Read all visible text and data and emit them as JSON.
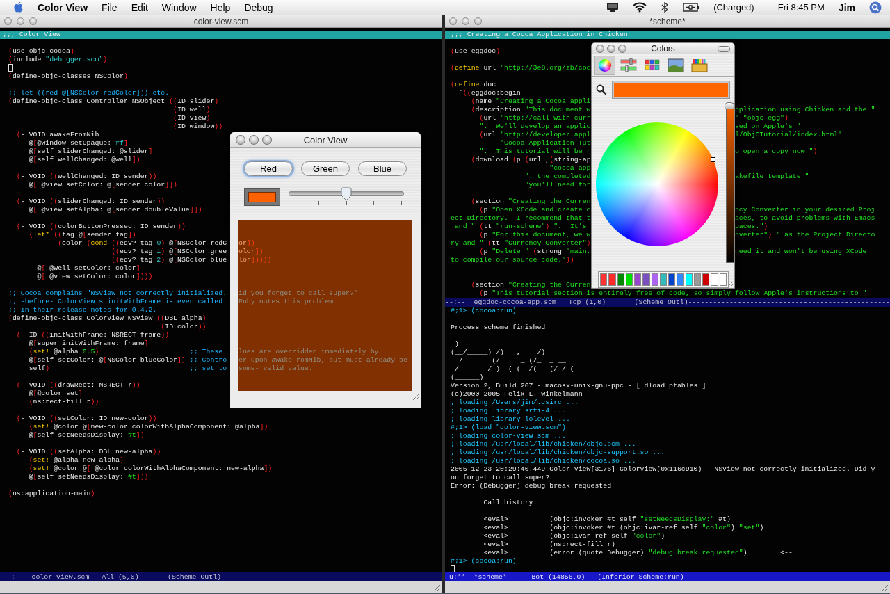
{
  "menubar": {
    "app": "Color View",
    "items": [
      "File",
      "Edit",
      "Window",
      "Help",
      "Debug"
    ],
    "battery": "(Charged)",
    "clock": "Fri 8:45 PM",
    "user": "Jim"
  },
  "editor_left": {
    "title": "color-view.scm",
    "header": ";;; Color View",
    "lines": [
      {
        "kind": "blank"
      },
      {
        "kind": "code",
        "segs": [
          {
            "kind": "code",
            "text": "(use objc cocoa)"
          }
        ]
      },
      {
        "kind": "code",
        "segs": [
          {
            "kind": "code",
            "text": "(include "
          },
          {
            "kind": "string",
            "text": "\"debugger.scm\""
          },
          {
            "kind": "code",
            "text": ")"
          }
        ]
      },
      {
        "kind": "cursor"
      },
      {
        "kind": "code",
        "segs": [
          {
            "kind": "code",
            "text": "(define-objc-classes NSColor)"
          }
        ]
      },
      {
        "kind": "blank"
      },
      {
        "kind": "code",
        "segs": [
          {
            "kind": "comment",
            "text": ";; let ((red @[NSColor redColor])) etc."
          }
        ]
      },
      {
        "kind": "code",
        "segs": [
          {
            "kind": "code",
            "text": "(define-objc-class Controller NSObject ((ID slider)"
          }
        ]
      },
      {
        "kind": "code",
        "segs": [
          {
            "kind": "code",
            "text": "                                        (ID well)"
          }
        ]
      },
      {
        "kind": "code",
        "segs": [
          {
            "kind": "code",
            "text": "                                        (ID view)"
          }
        ]
      },
      {
        "kind": "code",
        "segs": [
          {
            "kind": "code",
            "text": "                                        (ID window))"
          }
        ]
      },
      {
        "kind": "code",
        "segs": [
          {
            "kind": "code",
            "text": "  (- VOID awakeFromNib"
          }
        ]
      },
      {
        "kind": "code",
        "segs": [
          {
            "kind": "code",
            "text": "     @[@window setOpaque: "
          },
          {
            "kind": "constant",
            "text": "#f"
          },
          {
            "kind": "code",
            "text": "]"
          }
        ]
      },
      {
        "kind": "code",
        "segs": [
          {
            "kind": "code",
            "text": "     @[self sliderChanged: @slider]"
          }
        ]
      },
      {
        "kind": "code",
        "segs": [
          {
            "kind": "code",
            "text": "     @[self wellChanged: @well])"
          }
        ]
      },
      {
        "kind": "blank"
      },
      {
        "kind": "code",
        "segs": [
          {
            "kind": "code",
            "text": "  (- VOID ((wellChanged: ID sender))"
          }
        ]
      },
      {
        "kind": "code",
        "segs": [
          {
            "kind": "code",
            "text": "     @[ @view setColor: @[sender color]])"
          }
        ]
      },
      {
        "kind": "blank"
      },
      {
        "kind": "code",
        "segs": [
          {
            "kind": "code",
            "text": "  (- VOID ((sliderChanged: ID sender))"
          }
        ]
      },
      {
        "kind": "code",
        "segs": [
          {
            "kind": "code",
            "text": "     @[ @view setAlpha: @[sender doubleValue]])"
          }
        ]
      },
      {
        "kind": "blank"
      },
      {
        "kind": "code",
        "segs": [
          {
            "kind": "code",
            "text": "  (- VOID ((colorButtonPressed: ID sender))"
          }
        ]
      },
      {
        "kind": "code",
        "segs": [
          {
            "kind": "code",
            "text": "     ("
          },
          {
            "kind": "keyword",
            "text": "let*"
          },
          {
            "kind": "code",
            "text": " ((tag @[sender tag])"
          }
        ]
      },
      {
        "kind": "code",
        "segs": [
          {
            "kind": "code",
            "text": "            (color ("
          },
          {
            "kind": "keyword",
            "text": "cond"
          },
          {
            "kind": "code",
            "text": " ((eqv? tag "
          },
          {
            "kind": "constant",
            "text": "0"
          },
          {
            "kind": "code",
            "text": ") @[NSColor redC"
          }
        ],
        "after": [
          {
            "kind": "code",
            "text": "or])"
          }
        ]
      },
      {
        "kind": "code",
        "segs": [
          {
            "kind": "code",
            "text": "                         ((eqv? tag "
          },
          {
            "kind": "constant",
            "text": "1"
          },
          {
            "kind": "code",
            "text": ") @[NSColor gree"
          }
        ],
        "after": [
          {
            "kind": "code",
            "text": "olor])"
          }
        ]
      },
      {
        "kind": "code",
        "segs": [
          {
            "kind": "code",
            "text": "                         ((eqv? tag "
          },
          {
            "kind": "constant",
            "text": "2"
          },
          {
            "kind": "code",
            "text": ") @[NSColor blue"
          }
        ],
        "after": [
          {
            "kind": "code",
            "text": "lor]))))"
          }
        ]
      },
      {
        "kind": "code",
        "segs": [
          {
            "kind": "code",
            "text": "       @[ @well setColor: color]"
          }
        ]
      },
      {
        "kind": "code",
        "segs": [
          {
            "kind": "code",
            "text": "       @[ @view setColor: color])))"
          }
        ]
      },
      {
        "kind": "blank"
      },
      {
        "kind": "code",
        "segs": [
          {
            "kind": "comment",
            "text": ";; Cocoa complains \"NSView not correctly initialized."
          }
        ],
        "after": [
          {
            "kind": "comment",
            "text": "id you forget to call super?\""
          }
        ]
      },
      {
        "kind": "code",
        "segs": [
          {
            "kind": "comment",
            "text": ";; -before- ColorView's initWithFrame is even called."
          }
        ],
        "after": [
          {
            "kind": "comment",
            "text": "Ruby notes this problem"
          }
        ]
      },
      {
        "kind": "code",
        "segs": [
          {
            "kind": "comment",
            "text": ";; in their release notes for 0.4.2."
          }
        ]
      },
      {
        "kind": "code",
        "segs": [
          {
            "kind": "code",
            "text": "(define-objc-class ColorView NSView ((DBL alpha)"
          }
        ]
      },
      {
        "kind": "code",
        "segs": [
          {
            "kind": "code",
            "text": "                                     (ID color))"
          }
        ]
      },
      {
        "kind": "code",
        "segs": [
          {
            "kind": "code",
            "text": "  (- ID ((initWithFrame: NSRECT frame))"
          }
        ]
      },
      {
        "kind": "code",
        "segs": [
          {
            "kind": "code",
            "text": "     @[super initWithFrame: frame]"
          }
        ]
      },
      {
        "kind": "code",
        "segs": [
          {
            "kind": "code",
            "text": "     ("
          },
          {
            "kind": "keyword",
            "text": "set!"
          },
          {
            "kind": "code",
            "text": " @alpha "
          },
          {
            "kind": "number",
            "text": "0.5"
          },
          {
            "kind": "code",
            "text": ")                      "
          },
          {
            "kind": "comment",
            "text": ";; These"
          }
        ],
        "after": [
          {
            "kind": "comment",
            "text": "lues are overridden immediately by"
          }
        ]
      },
      {
        "kind": "code",
        "segs": [
          {
            "kind": "code",
            "text": "     @[self setColor: @[NSColor blueColor]] "
          },
          {
            "kind": "comment",
            "text": ";; Contro"
          }
        ],
        "after": [
          {
            "kind": "comment",
            "text": "er upon awakeFromNib, but must already be"
          }
        ]
      },
      {
        "kind": "code",
        "segs": [
          {
            "kind": "code",
            "text": "     self)                                  "
          },
          {
            "kind": "comment",
            "text": ";; set to"
          }
        ],
        "after": [
          {
            "kind": "comment",
            "text": "some- valid value."
          }
        ]
      },
      {
        "kind": "blank"
      },
      {
        "kind": "code",
        "segs": [
          {
            "kind": "code",
            "text": "  (- VOID ((drawRect: NSRECT r))"
          }
        ]
      },
      {
        "kind": "code",
        "segs": [
          {
            "kind": "code",
            "text": "     @[@color set]"
          }
        ]
      },
      {
        "kind": "code",
        "segs": [
          {
            "kind": "code",
            "text": "     (ns:rect-fill r))"
          }
        ]
      },
      {
        "kind": "blank"
      },
      {
        "kind": "code",
        "segs": [
          {
            "kind": "code",
            "text": "  (- VOID ((setColor: ID new-color))"
          }
        ]
      },
      {
        "kind": "code",
        "segs": [
          {
            "kind": "code",
            "text": "     ("
          },
          {
            "kind": "keyword",
            "text": "set!"
          },
          {
            "kind": "code",
            "text": " @color @[new-color colorWithAlphaComponent: @alpha])"
          }
        ]
      },
      {
        "kind": "code",
        "segs": [
          {
            "kind": "code",
            "text": "     @[self setNeedsDisplay: "
          },
          {
            "kind": "number",
            "text": "#t"
          },
          {
            "kind": "code",
            "text": "])"
          }
        ]
      },
      {
        "kind": "blank"
      },
      {
        "kind": "code",
        "segs": [
          {
            "kind": "code",
            "text": "  (- VOID ((setAlpha: DBL new-alpha))"
          }
        ]
      },
      {
        "kind": "code",
        "segs": [
          {
            "kind": "code",
            "text": "     ("
          },
          {
            "kind": "keyword",
            "text": "set!"
          },
          {
            "kind": "code",
            "text": " @alpha new-alpha)"
          }
        ]
      },
      {
        "kind": "code",
        "segs": [
          {
            "kind": "code",
            "text": "     ("
          },
          {
            "kind": "keyword",
            "text": "set!"
          },
          {
            "kind": "code",
            "text": " @color @[ @color colorWithAlphaComponent: new-alpha])"
          }
        ]
      },
      {
        "kind": "code",
        "segs": [
          {
            "kind": "code",
            "text": "     @[self setNeedsDisplay: "
          },
          {
            "kind": "number",
            "text": "#t"
          },
          {
            "kind": "code",
            "text": "]))"
          }
        ]
      },
      {
        "kind": "blank"
      },
      {
        "kind": "code",
        "segs": [
          {
            "kind": "code",
            "text": "(ns:application-main)"
          }
        ]
      }
    ],
    "mode_line": "--:--  color-view.scm   All (5,0)       (Scheme Outl)----------------------------------------------------"
  },
  "editor_right": {
    "title": "*scheme*",
    "header": ";;; Creating a Cocoa Application in Chicken",
    "top_lines": [
      {
        "kind": "blank"
      },
      {
        "kind": "code",
        "segs": [
          {
            "kind": "code",
            "text": "(use eggdoc)"
          }
        ]
      },
      {
        "kind": "blank"
      },
      {
        "kind": "code",
        "segs": [
          {
            "kind": "code",
            "text": "("
          },
          {
            "kind": "keyword",
            "text": "define"
          },
          {
            "kind": "code",
            "text": " url "
          },
          {
            "kind": "green",
            "text": "\"http://3e8.org/zb/coc"
          }
        ]
      },
      {
        "kind": "blank"
      },
      {
        "kind": "code",
        "segs": [
          {
            "kind": "code",
            "text": "("
          },
          {
            "kind": "keyword",
            "text": "define"
          },
          {
            "kind": "code",
            "text": " doc"
          }
        ]
      },
      {
        "kind": "code",
        "segs": [
          {
            "kind": "code",
            "text": "  `((eggdoc:begin"
          }
        ]
      },
      {
        "kind": "code",
        "segs": [
          {
            "kind": "code",
            "text": "     (name "
          },
          {
            "kind": "green",
            "text": "\"Creating a Cocoa appli"
          }
        ]
      },
      {
        "kind": "code",
        "segs": [
          {
            "kind": "code",
            "text": "     (description "
          },
          {
            "kind": "green",
            "text": "\"This document w"
          }
        ],
        "after": [
          {
            "kind": "green",
            "text": "pplication using Chicken and the \""
          }
        ]
      },
      {
        "kind": "code",
        "segs": [
          {
            "kind": "code",
            "text": "       (url "
          },
          {
            "kind": "green",
            "text": "\"http://call-with-curr"
          }
        ],
        "after": [
          {
            "kind": "green",
            "text": "\" \"objc egg\""
          },
          {
            "kind": "code",
            "text": ")"
          }
        ]
      },
      {
        "kind": "code",
        "segs": [
          {
            "kind": "green",
            "text": "       \".  We'll develop an applic"
          }
        ],
        "after": [
          {
            "kind": "green",
            "text": "sed on Apple's \""
          }
        ]
      },
      {
        "kind": "code",
        "segs": [
          {
            "kind": "code",
            "text": "       (url "
          },
          {
            "kind": "green",
            "text": "\"http://developer.appl"
          }
        ],
        "after": [
          {
            "kind": "green",
            "text": "l/ObjCTutorial/index.html\""
          }
        ]
      },
      {
        "kind": "code",
        "segs": [
          {
            "kind": "green",
            "text": "            \"Cocoa Application Tut"
          }
        ]
      },
      {
        "kind": "code",
        "segs": [
          {
            "kind": "green",
            "text": "       \".  This tutorial will be r"
          }
        ],
        "after": [
          {
            "kind": "green",
            "text": "o open a copy now.\""
          },
          {
            "kind": "code",
            "text": ")"
          }
        ]
      },
      {
        "kind": "code",
        "segs": [
          {
            "kind": "code",
            "text": "     (download (p (url ,(string-ap"
          }
        ]
      },
      {
        "kind": "code",
        "segs": [
          {
            "kind": "green",
            "text": "                        \"cocoa-app"
          }
        ]
      },
      {
        "kind": "code",
        "segs": [
          {
            "kind": "green",
            "text": "                  \": the completed"
          }
        ],
        "after": [
          {
            "kind": "green",
            "text": "akefile template \""
          }
        ]
      },
      {
        "kind": "code",
        "segs": [
          {
            "kind": "green",
            "text": "                  \"you'll need for"
          }
        ]
      },
      {
        "kind": "blank"
      },
      {
        "kind": "code",
        "segs": [
          {
            "kind": "code",
            "text": "     (section "
          },
          {
            "kind": "green",
            "text": "\"Creating the Curren"
          }
        ]
      },
      {
        "kind": "code",
        "segs": [
          {
            "kind": "code",
            "text": "       (p "
          },
          {
            "kind": "green",
            "text": "\"Open XCode and create c"
          }
        ],
        "after": [
          {
            "kind": "green",
            "text": "ncy Converter in your desired Proj"
          }
        ]
      },
      {
        "kind": "code",
        "segs": [
          {
            "kind": "green",
            "text": "ect Directory.  I recommend that t"
          }
        ],
        "after": [
          {
            "kind": "green",
            "text": "aces, to avoid problems with Emacs"
          }
        ]
      },
      {
        "kind": "code",
        "segs": [
          {
            "kind": "green",
            "text": " and \" "
          },
          {
            "kind": "code",
            "text": "(tt "
          },
          {
            "kind": "green",
            "text": "\"run-scheme\""
          },
          {
            "kind": "code",
            "text": ") "
          },
          {
            "kind": "green",
            "text": "\".  It's"
          }
        ],
        "after": [
          {
            "kind": "green",
            "text": "paces.\""
          },
          {
            "kind": "code",
            "text": ")"
          }
        ]
      },
      {
        "kind": "code",
        "segs": [
          {
            "kind": "code",
            "text": "       (p "
          },
          {
            "kind": "green",
            "text": "\"For this document, we w"
          }
        ],
        "after": [
          {
            "kind": "green",
            "text": "nverter\""
          },
          {
            "kind": "code",
            "text": ") "
          },
          {
            "kind": "green",
            "text": "\" as the Project Directo"
          }
        ]
      },
      {
        "kind": "code",
        "segs": [
          {
            "kind": "green",
            "text": "ry and \" "
          },
          {
            "kind": "code",
            "text": "(tt "
          },
          {
            "kind": "green",
            "text": "\"Currency Converter\""
          },
          {
            "kind": "code",
            "text": ")"
          }
        ]
      },
      {
        "kind": "code",
        "segs": [
          {
            "kind": "code",
            "text": "       (p "
          },
          {
            "kind": "green",
            "text": "\"Delete \" "
          },
          {
            "kind": "code",
            "text": "(strong "
          },
          {
            "kind": "green",
            "text": "\"main."
          }
        ],
        "after": [
          {
            "kind": "green",
            "text": "need it and won't be using XCode"
          }
        ]
      },
      {
        "kind": "code",
        "segs": [
          {
            "kind": "green",
            "text": "to compile our source code.\""
          },
          {
            "kind": "code",
            "text": "))"
          }
        ]
      },
      {
        "kind": "blank"
      },
      {
        "kind": "blank"
      },
      {
        "kind": "code",
        "segs": [
          {
            "kind": "code",
            "text": "     (section "
          },
          {
            "kind": "green",
            "text": "\"Creating the Curren"
          }
        ]
      },
      {
        "kind": "code",
        "segs": [
          {
            "kind": "code",
            "text": "       (p "
          },
          {
            "kind": "green",
            "text": "\"This tutorial section is entirely free of code, so simply follow Apple's instructions to \""
          }
        ]
      }
    ],
    "top_mode_line": "--:--  eggdoc-cocoa-app.scm   Top (1,0)       (Scheme Outl)-------------------------------------------------",
    "bottom_lines": [
      {
        "kind": "code",
        "segs": [
          {
            "kind": "prompt",
            "text": "#;1> (cocoa:run)"
          }
        ]
      },
      {
        "kind": "blank"
      },
      {
        "kind": "code",
        "segs": [
          {
            "kind": "plain",
            "text": "Process scheme finished"
          }
        ]
      },
      {
        "kind": "blank"
      },
      {
        "kind": "code",
        "segs": [
          {
            "kind": "plain",
            "text": " )   ___"
          }
        ]
      },
      {
        "kind": "code",
        "segs": [
          {
            "kind": "plain",
            "text": "(__/_____) /)   ,    /)"
          }
        ]
      },
      {
        "kind": "code",
        "segs": [
          {
            "kind": "plain",
            "text": "  /       (/     _ (/_  _ __"
          }
        ]
      },
      {
        "kind": "code",
        "segs": [
          {
            "kind": "plain",
            "text": " /       / )__(_(__/(___(/_/ (_"
          }
        ]
      },
      {
        "kind": "code",
        "segs": [
          {
            "kind": "plain",
            "text": "(______)"
          }
        ]
      },
      {
        "kind": "code",
        "segs": [
          {
            "kind": "plain",
            "text": "Version 2, Build 207 - macosx-unix-gnu-ppc - [ dload ptables ]"
          }
        ]
      },
      {
        "kind": "code",
        "segs": [
          {
            "kind": "plain",
            "text": "(c)2000-2005 Felix L. Winkelmann"
          }
        ]
      },
      {
        "kind": "code",
        "segs": [
          {
            "kind": "prompt",
            "text": "; loading /Users/jim/.csirc ..."
          }
        ]
      },
      {
        "kind": "code",
        "segs": [
          {
            "kind": "prompt",
            "text": "; loading library srfi-4 ..."
          }
        ]
      },
      {
        "kind": "code",
        "segs": [
          {
            "kind": "prompt",
            "text": "; loading library lolevel ..."
          }
        ]
      },
      {
        "kind": "code",
        "segs": [
          {
            "kind": "prompt",
            "text": "#;1> (load \"color-view.scm\")"
          }
        ]
      },
      {
        "kind": "code",
        "segs": [
          {
            "kind": "prompt",
            "text": "; loading color-view.scm ..."
          }
        ]
      },
      {
        "kind": "code",
        "segs": [
          {
            "kind": "prompt",
            "text": "; loading /usr/local/lib/chicken/objc.scm ..."
          }
        ]
      },
      {
        "kind": "code",
        "segs": [
          {
            "kind": "prompt",
            "text": "; loading /usr/local/lib/chicken/objc-support.so ..."
          }
        ]
      },
      {
        "kind": "code",
        "segs": [
          {
            "kind": "prompt",
            "text": "; loading /usr/local/lib/chicken/cocoa.so ..."
          }
        ]
      },
      {
        "kind": "code",
        "segs": [
          {
            "kind": "plain",
            "text": "2005-12-23 20:29:40.449 Color View[3176] ColorView(0x116c910) - NSView not correctly initialized. Did y"
          }
        ]
      },
      {
        "kind": "code",
        "segs": [
          {
            "kind": "plain",
            "text": "ou forget to call super?"
          }
        ]
      },
      {
        "kind": "code",
        "segs": [
          {
            "kind": "plain",
            "text": "Error: (Debugger) debug break requested"
          }
        ]
      },
      {
        "kind": "blank"
      },
      {
        "kind": "code",
        "segs": [
          {
            "kind": "plain",
            "text": "        Call history:"
          }
        ]
      },
      {
        "kind": "blank"
      },
      {
        "kind": "code",
        "segs": [
          {
            "kind": "plain",
            "text": "        <eval>          (objc:invoker #t self "
          },
          {
            "kind": "green",
            "text": "\"setNeedsDisplay:\""
          },
          {
            "kind": "plain",
            "text": " #t)"
          }
        ]
      },
      {
        "kind": "code",
        "segs": [
          {
            "kind": "plain",
            "text": "        <eval>          (objc:invoker #t (objc:ivar-ref self "
          },
          {
            "kind": "green",
            "text": "\"color\""
          },
          {
            "kind": "plain",
            "text": ") "
          },
          {
            "kind": "green",
            "text": "\"set\""
          },
          {
            "kind": "plain",
            "text": ")"
          }
        ]
      },
      {
        "kind": "code",
        "segs": [
          {
            "kind": "plain",
            "text": "        <eval>          (objc:ivar-ref self "
          },
          {
            "kind": "green",
            "text": "\"color\""
          },
          {
            "kind": "plain",
            "text": ")"
          }
        ]
      },
      {
        "kind": "code",
        "segs": [
          {
            "kind": "plain",
            "text": "        <eval>          (ns:rect-fill r)"
          }
        ]
      },
      {
        "kind": "code",
        "segs": [
          {
            "kind": "plain",
            "text": "        <eval>          (error (quote Debugger) "
          },
          {
            "kind": "green",
            "text": "\"debug break requested\""
          },
          {
            "kind": "plain",
            "text": ")        <--"
          }
        ]
      },
      {
        "kind": "code",
        "segs": [
          {
            "kind": "prompt",
            "text": "#;1> (cocoa:run)"
          }
        ]
      },
      {
        "kind": "cursor"
      }
    ],
    "bottom_mode_line": "-u:**  *scheme*      Bot (14856,0)   (Inferior Scheme:run)-------------------------------------------------"
  },
  "color_view": {
    "title": "Color View",
    "buttons": [
      {
        "label": "Red",
        "selected": true
      },
      {
        "label": "Green",
        "selected": false
      },
      {
        "label": "Blue",
        "selected": false
      }
    ],
    "well": {
      "color": "#ff6000"
    },
    "slider": {
      "level": 0.5
    }
  },
  "colors_panel": {
    "title": "Colors",
    "modes": [
      {
        "kind": "wheel",
        "selected": true
      },
      {
        "kind": "sliders",
        "selected": false
      },
      {
        "kind": "palettes",
        "selected": false
      },
      {
        "kind": "image",
        "selected": false
      },
      {
        "kind": "crayons",
        "selected": false
      }
    ],
    "current": {
      "color": "#ff6600"
    },
    "brightness": {
      "level": 1
    },
    "swatches": [
      {
        "color": "#ff3333"
      },
      {
        "color": "#ff2a2a"
      },
      {
        "color": "#008800"
      },
      {
        "color": "#00dd00"
      },
      {
        "color": "#9944cc"
      },
      {
        "color": "#7a4fbf"
      },
      {
        "color": "#aa66ee"
      },
      {
        "color": "#33bbbb"
      },
      {
        "color": "#0044cc"
      },
      {
        "color": "#3388ff"
      },
      {
        "color": "#00ffff"
      },
      {
        "color": "#999999"
      },
      {
        "color": "#cc0000"
      },
      {
        "color": "#ffffff"
      },
      {
        "color": "#ffffff"
      }
    ]
  }
}
